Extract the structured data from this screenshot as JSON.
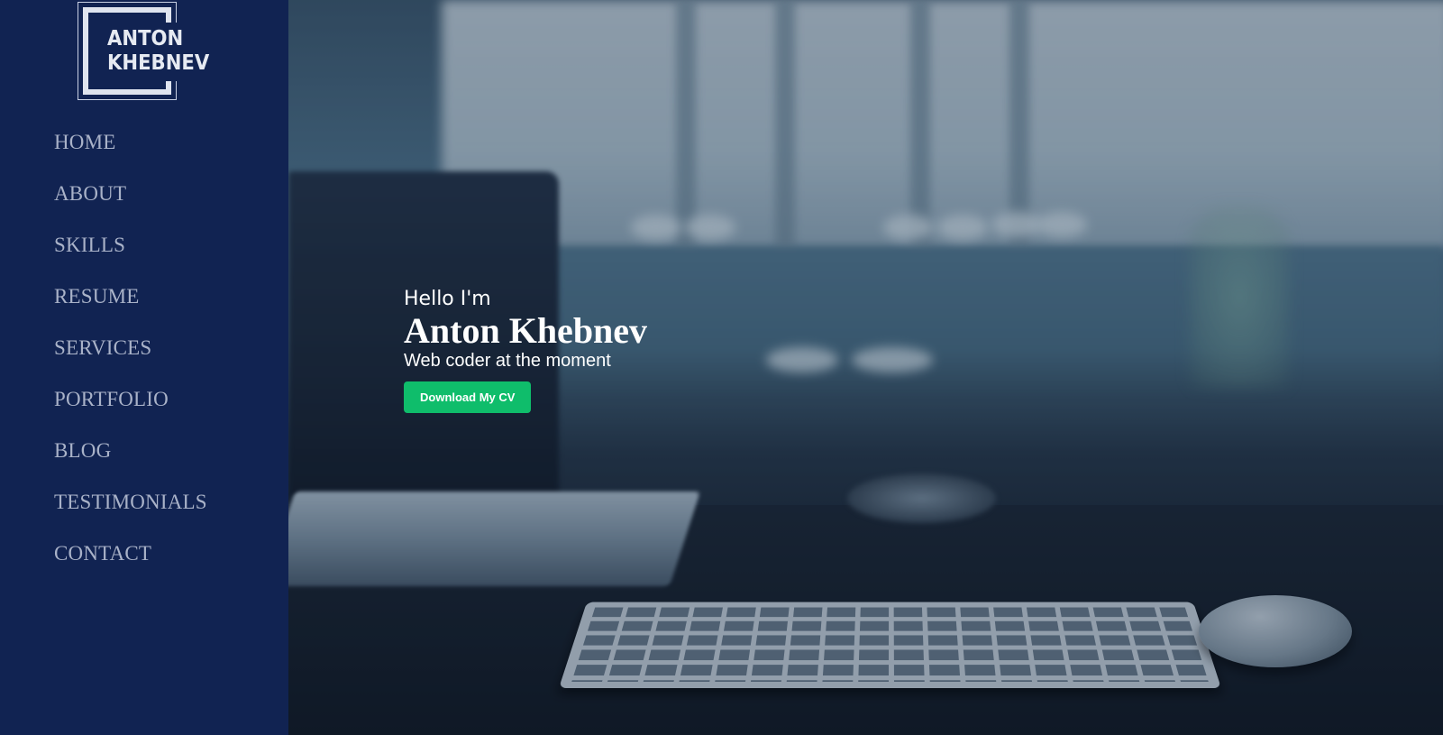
{
  "logo": {
    "line1": "ANTON",
    "line2": "KHEBNEV"
  },
  "nav": {
    "items": [
      {
        "label": "HOME"
      },
      {
        "label": "ABOUT"
      },
      {
        "label": "SKILLS"
      },
      {
        "label": "RESUME"
      },
      {
        "label": "SERVICES"
      },
      {
        "label": "PORTFOLIO"
      },
      {
        "label": "BLOG"
      },
      {
        "label": "TESTIMONIALS"
      },
      {
        "label": "CONTACT"
      }
    ]
  },
  "hero": {
    "greeting": "Hello I'm",
    "name": "Anton Khebnev",
    "tagline": "Web coder at the moment",
    "cta_label": "Download My CV"
  },
  "colors": {
    "sidebar": "#112352",
    "nav_text": "#a9b2c8",
    "cta": "#0fbd6b",
    "hero_text": "#ffffff"
  }
}
